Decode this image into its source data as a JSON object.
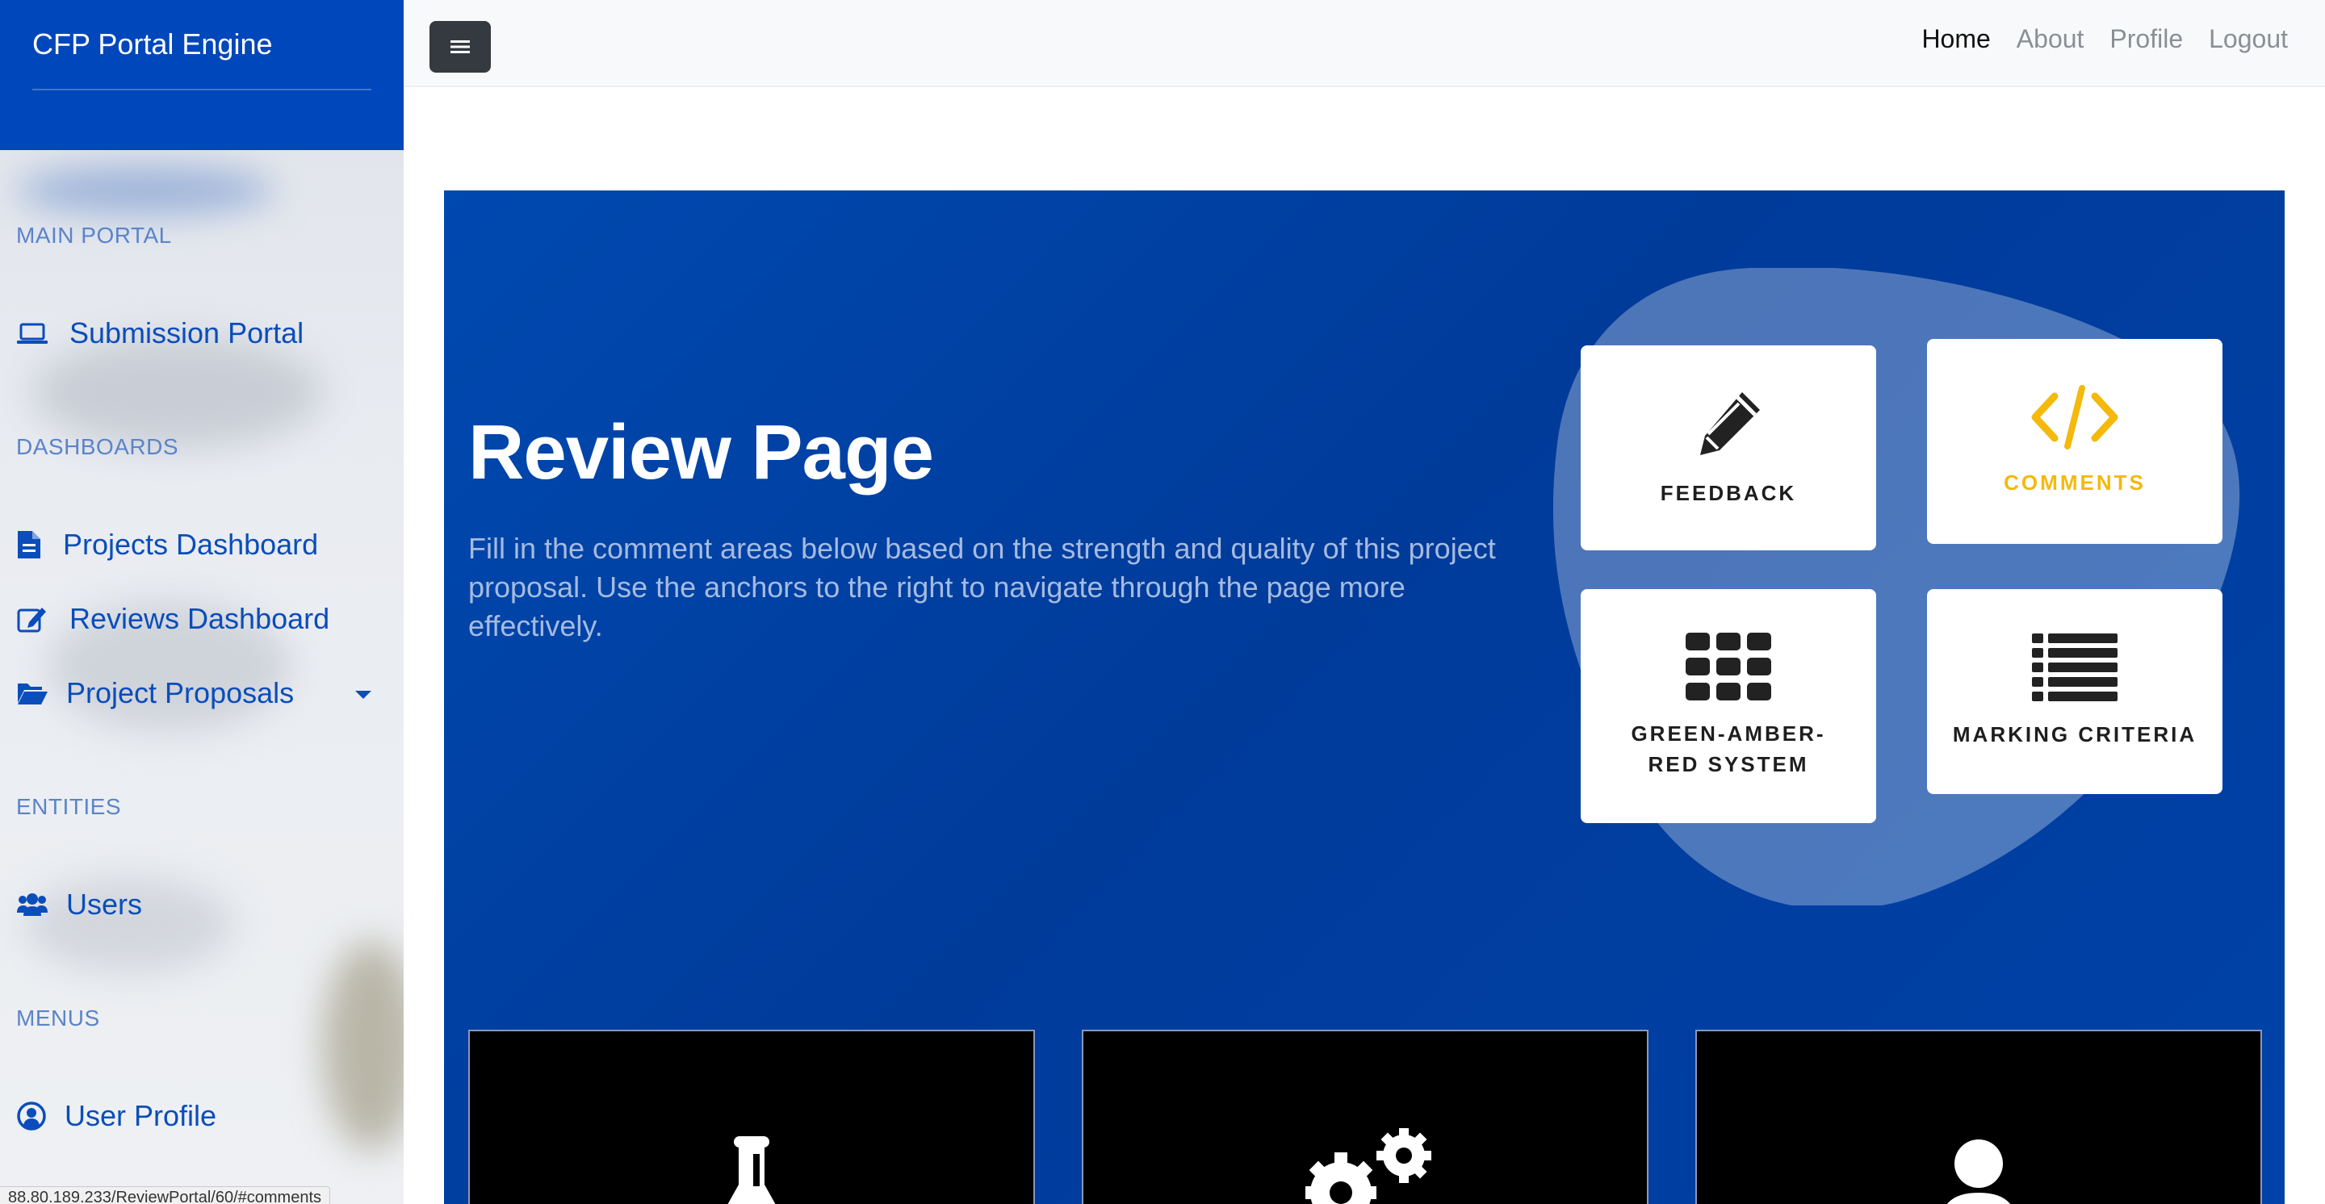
{
  "sidebar": {
    "brand": "CFP Portal Engine",
    "sections": {
      "main_portal": "MAIN PORTAL",
      "dashboards": "DASHBOARDS",
      "entities": "ENTITIES",
      "menus": "MENUS"
    },
    "items": {
      "submission_portal": "Submission Portal",
      "projects_dashboard": "Projects Dashboard",
      "reviews_dashboard": "Reviews Dashboard",
      "project_proposals": "Project Proposals",
      "users": "Users",
      "user_profile": "User Profile"
    }
  },
  "topbar": {
    "nav": {
      "home": "Home",
      "about": "About",
      "profile": "Profile",
      "logout": "Logout"
    },
    "active": "Home"
  },
  "hero": {
    "title": "Review Page",
    "description": "Fill in the comment areas below based on the strength and quality of this project proposal. Use the anchors to the right to navigate through the page more effectively."
  },
  "cards": {
    "feedback": {
      "label": "FEEDBACK",
      "icon": "pencil-icon"
    },
    "comments": {
      "label": "COMMENTS",
      "icon": "code-icon"
    },
    "gar": {
      "label": "GREEN-AMBER-RED SYSTEM",
      "icon": "grid-icon"
    },
    "marking": {
      "label": "MARKING CRITERIA",
      "icon": "list-icon"
    }
  },
  "panels": [
    {
      "icon": "flask-icon"
    },
    {
      "icon": "gears-icon"
    },
    {
      "icon": "user-icon"
    }
  ],
  "status_url": "88.80.189.233/ReviewPortal/60/#comments",
  "colors": {
    "primary": "#0047bb",
    "accent_yellow": "#f4b90b",
    "hero_bg": "#003b9a"
  }
}
